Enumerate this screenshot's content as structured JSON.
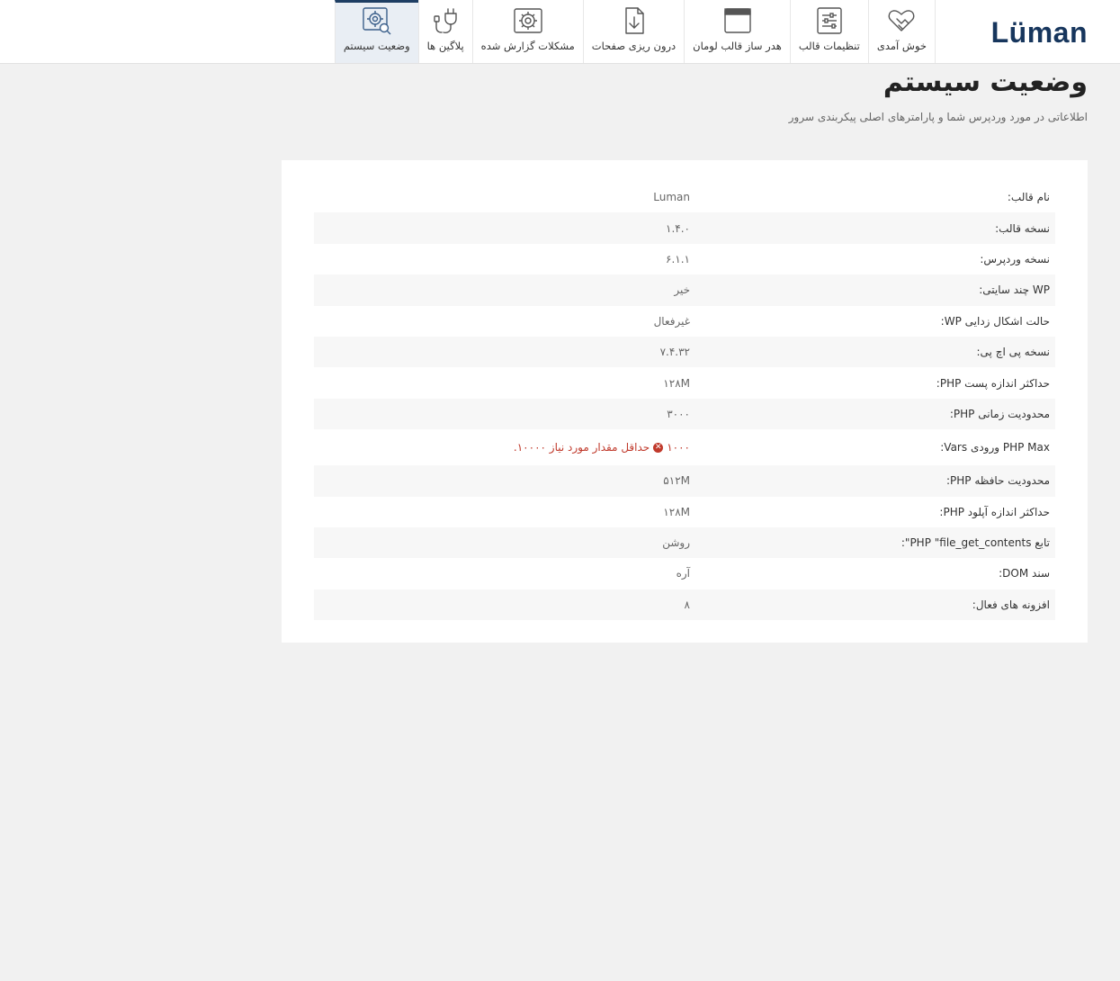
{
  "brand": {
    "logo_text": "Lüman"
  },
  "nav": {
    "tabs": [
      {
        "label": "خوش آمدی",
        "icon": "handshake-icon",
        "active": false
      },
      {
        "label": "تنظیمات قالب",
        "icon": "sliders-icon",
        "active": false
      },
      {
        "label": "هدر ساز قالب لومان",
        "icon": "window-icon",
        "active": false
      },
      {
        "label": "درون ریزی صفحات",
        "icon": "file-import-icon",
        "active": false
      },
      {
        "label": "مشکلات گزارش شده",
        "icon": "gear-frame-icon",
        "active": false
      },
      {
        "label": "پلاگین ها",
        "icon": "plug-icon",
        "active": false
      },
      {
        "label": "وضعیت سیستم",
        "icon": "system-search-icon",
        "active": true
      }
    ]
  },
  "header": {
    "title": "وضعیت سیستم",
    "subtitle": "اطلاعاتی در مورد وردپرس شما و پارامترهای اصلی پیکربندی سرور"
  },
  "status": {
    "rows": [
      {
        "label": "نام قالب:",
        "value": "Luman"
      },
      {
        "label": "نسخه قالب:",
        "value": "۱.۴.۰"
      },
      {
        "label": "نسخه وردپرس:",
        "value": "۶.۱.۱"
      },
      {
        "label": "WP چند سایتی:",
        "value": "خیر"
      },
      {
        "label": "حالت اشکال زدایی WP:",
        "value": "غیرفعال"
      },
      {
        "label": "نسخه پی اچ پی:",
        "value": "۷.۴.۳۲"
      },
      {
        "label": "حداکثر اندازه پست PHP:",
        "value": "۱۲۸M"
      },
      {
        "label": "محدودیت زمانی PHP:",
        "value": "۳۰۰۰"
      },
      {
        "label": "PHP Max ورودی Vars:",
        "value": "۱۰۰۰",
        "error": true,
        "error_text": "حداقل مقدار مورد نیاز ۱۰۰۰۰."
      },
      {
        "label": "محدودیت حافظه PHP:",
        "value": "۵۱۲M"
      },
      {
        "label": "حداکثر اندازه آپلود PHP:",
        "value": "۱۲۸M"
      },
      {
        "label": "تابع PHP \"file_get_contents\":",
        "value": "روشن"
      },
      {
        "label": "سند DOM:",
        "value": "آره"
      },
      {
        "label": "افزونه های فعال:",
        "value": "۸"
      }
    ],
    "error_color": "#c0392b"
  },
  "colors": {
    "brand": "#17365d",
    "active_tab_bg": "#e9eef4",
    "page_bg": "#f1f1f1"
  }
}
